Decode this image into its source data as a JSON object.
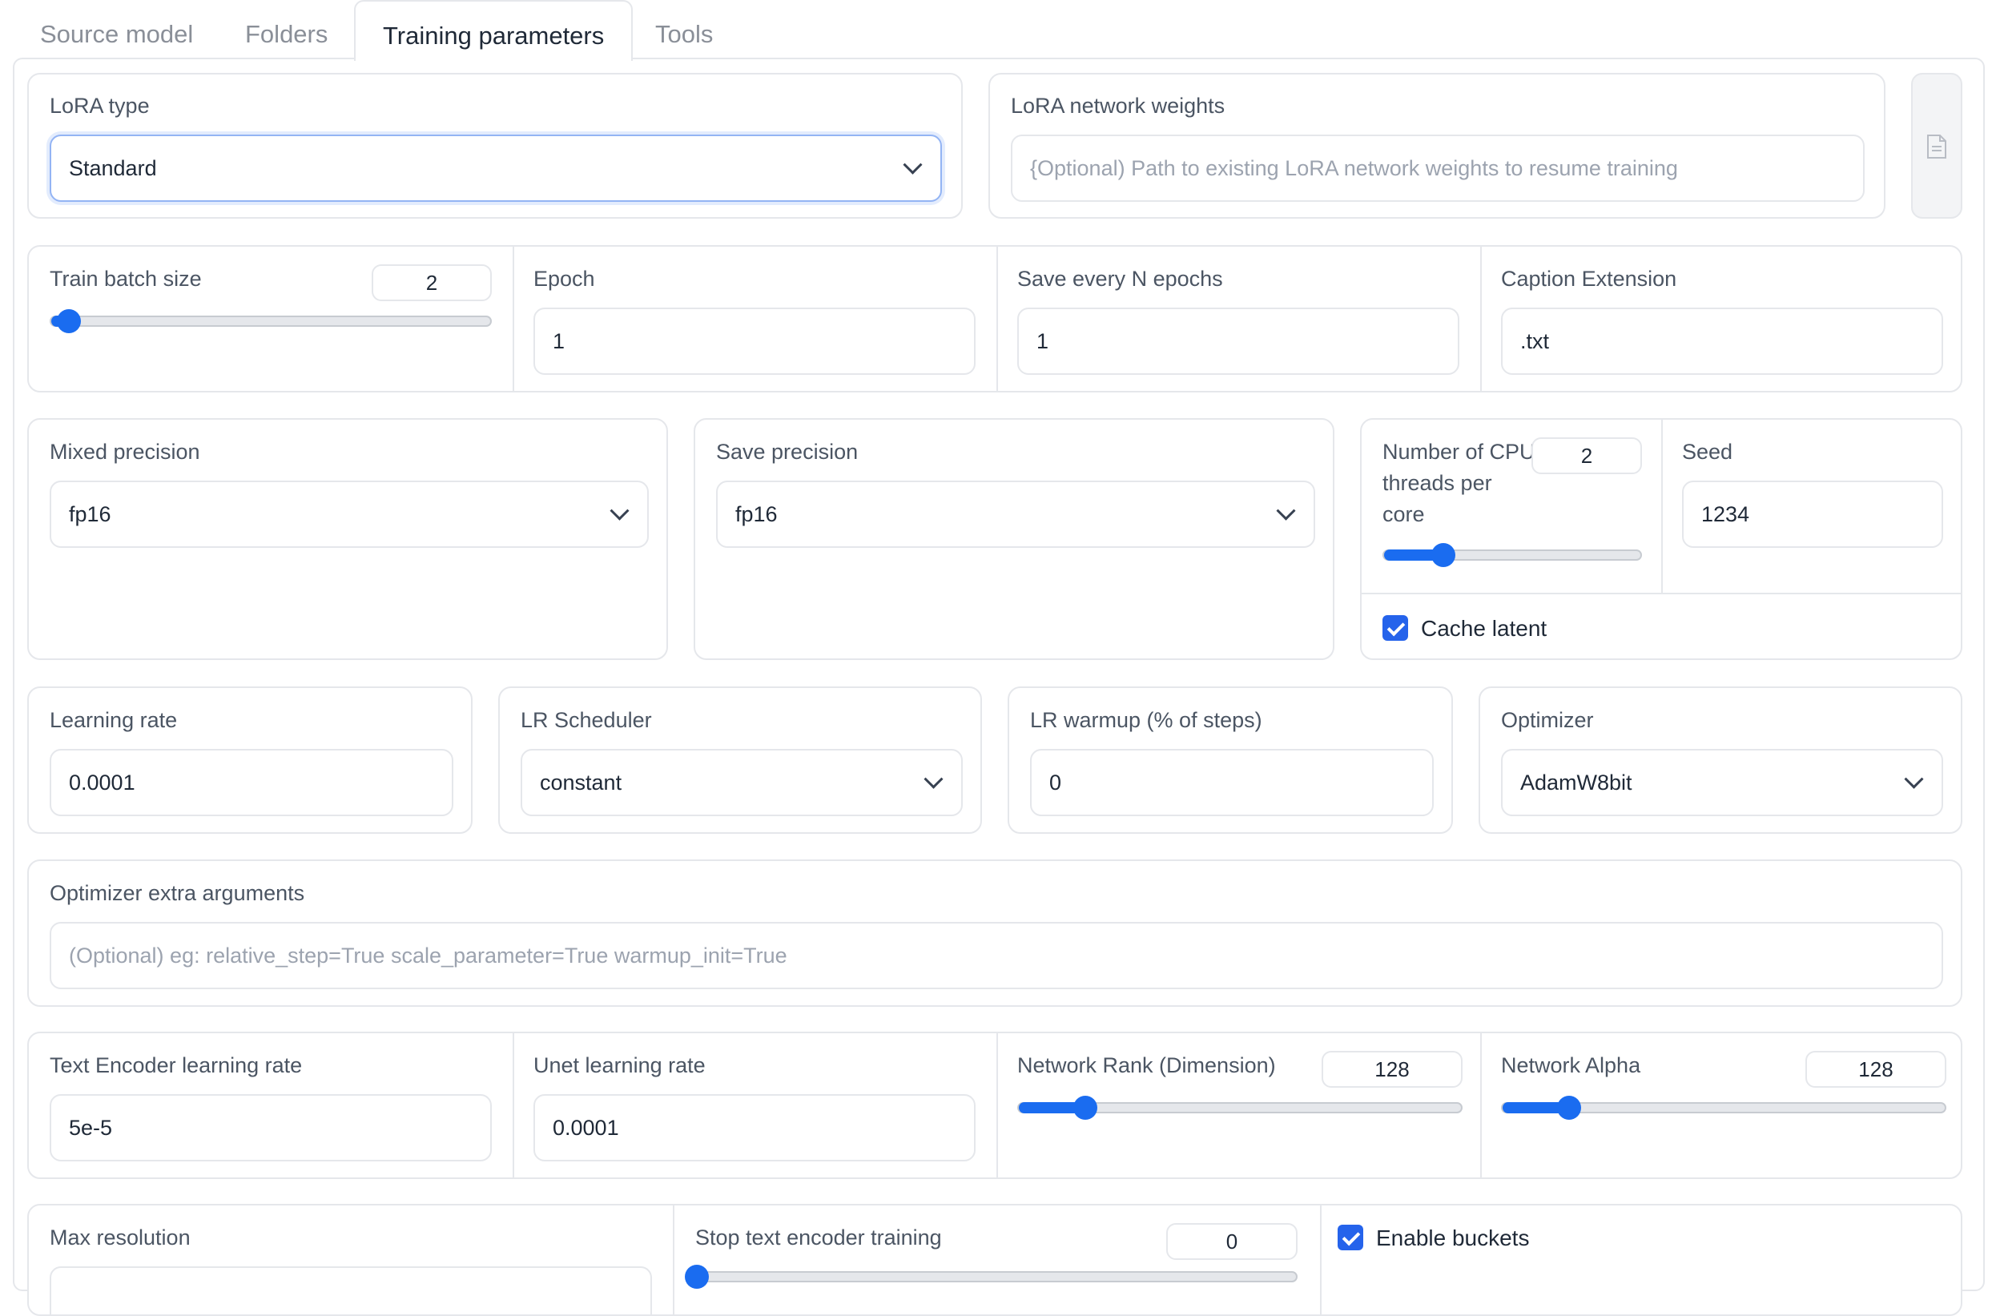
{
  "tabs": [
    "Source model",
    "Folders",
    "Training parameters",
    "Tools"
  ],
  "lora_type": {
    "label": "LoRA type",
    "value": "Standard"
  },
  "lora_weights": {
    "label": "LoRA network weights",
    "placeholder": "{Optional) Path to existing LoRA network weights to resume training"
  },
  "file_button_icon": "file-icon",
  "train_batch_size": {
    "label": "Train batch size",
    "value": "2",
    "min": 1,
    "max": 64,
    "fraction": 0.04
  },
  "epoch": {
    "label": "Epoch",
    "value": "1"
  },
  "save_every": {
    "label": "Save every N epochs",
    "value": "1"
  },
  "caption_ext": {
    "label": "Caption Extension",
    "value": ".txt"
  },
  "mixed_precision": {
    "label": "Mixed precision",
    "value": "fp16"
  },
  "save_precision": {
    "label": "Save precision",
    "value": "fp16"
  },
  "cpu_threads": {
    "label_lines": [
      "Number of CPU",
      "threads per",
      "core"
    ],
    "value": "2",
    "fraction": 0.23
  },
  "seed": {
    "label": "Seed",
    "value": "1234"
  },
  "cache_latent": {
    "label": "Cache latent",
    "checked": true
  },
  "learning_rate": {
    "label": "Learning rate",
    "value": "0.0001"
  },
  "lr_scheduler": {
    "label": "LR Scheduler",
    "value": "constant"
  },
  "lr_warmup": {
    "label": "LR warmup (% of steps)",
    "value": "0"
  },
  "optimizer": {
    "label": "Optimizer",
    "value": "AdamW8bit"
  },
  "optimizer_args": {
    "label": "Optimizer extra arguments",
    "placeholder": "(Optional) eg: relative_step=True scale_parameter=True warmup_init=True"
  },
  "text_encoder_lr": {
    "label": "Text Encoder learning rate",
    "value": "5e-5"
  },
  "unet_lr": {
    "label": "Unet learning rate",
    "value": "0.0001"
  },
  "network_rank": {
    "label": "Network Rank (Dimension)",
    "value": "128",
    "fraction": 0.15
  },
  "network_alpha": {
    "label": "Network Alpha",
    "value": "128",
    "fraction": 0.15
  },
  "max_resolution": {
    "label": "Max resolution"
  },
  "stop_text_encoder": {
    "label": "Stop text encoder training",
    "value": "0",
    "fraction": 0.0
  },
  "enable_buckets": {
    "label": "Enable buckets",
    "checked": true
  },
  "colors": {
    "accent": "#1a6cf0",
    "border": "#e5e7eb",
    "focus": "#93b4f4",
    "muted_text": "#8a8f98"
  }
}
